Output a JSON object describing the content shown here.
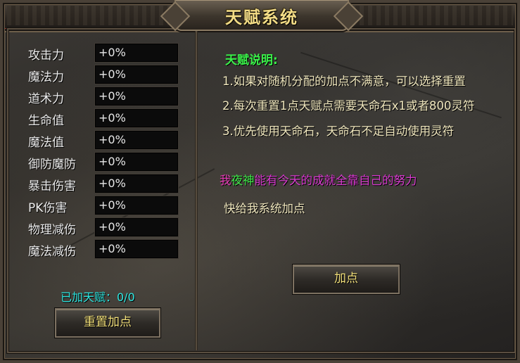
{
  "window": {
    "title": "天赋系统"
  },
  "stats": [
    {
      "label": "攻击力",
      "value": "+0%"
    },
    {
      "label": "魔法力",
      "value": "+0%"
    },
    {
      "label": "道术力",
      "value": "+0%"
    },
    {
      "label": "生命值",
      "value": "+0%"
    },
    {
      "label": "魔法值",
      "value": "+0%"
    },
    {
      "label": "御防魔防",
      "value": "+0%"
    },
    {
      "label": "暴击伤害",
      "value": "+0%"
    },
    {
      "label": "PK伤害",
      "value": "+0%"
    },
    {
      "label": "物理减伤",
      "value": "+0%"
    },
    {
      "label": "魔法减伤",
      "value": "+0%"
    }
  ],
  "added_talent": "已加天赋：0/0",
  "buttons": {
    "reset": "重置加点",
    "add_points": "加点"
  },
  "description": {
    "title": "天赋说明:",
    "lines": [
      "1.如果对随机分配的加点不满意，可以选择重置",
      "2.每次重置1点天赋点需要天命石x1或者800灵符",
      "3.优先使用天命石，天命石不足自动使用灵符"
    ]
  },
  "motto": {
    "part1": "我",
    "part2": "夜神",
    "part3": "能有今天的成就全靠自己的努力"
  },
  "prompt": "快给我系统加点",
  "colors": {
    "title_gold": "#f3dc86",
    "desc_title_green": "#3bf04a",
    "talent_cyan": "#2ee6e0",
    "motto_magenta": "#e63cb7",
    "motto_green": "#40e84a",
    "button_text": "#f2df7a"
  }
}
